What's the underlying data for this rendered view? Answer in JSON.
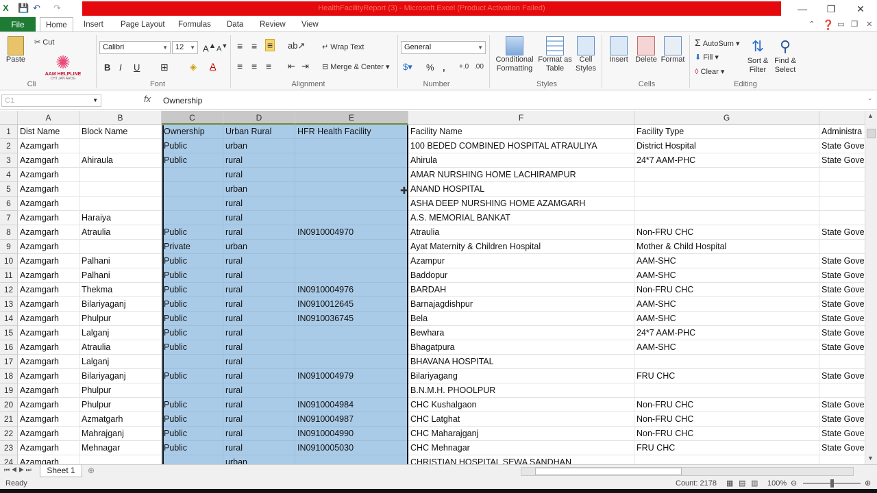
{
  "window": {
    "title": "HealthFacilityReport (3) - Microsoft Excel (Product Activation Failed)",
    "minimize": "—",
    "restore": "❐",
    "close": "✕"
  },
  "quick_access": {
    "save": "💾",
    "undo": "↶",
    "redo": "↷"
  },
  "ribbon_tabs": [
    "Home",
    "Insert",
    "Page Layout",
    "Formulas",
    "Data",
    "Review",
    "View"
  ],
  "file_tab": "File",
  "clipboard": {
    "paste": "Paste",
    "cut": "Cut",
    "label": "Cli"
  },
  "font": {
    "name": "Calibri",
    "size": "12",
    "bold": "B",
    "italic": "I",
    "underline": "U",
    "label": "Font"
  },
  "alignment": {
    "wrap": "Wrap Text",
    "merge": "Merge & Center",
    "label": "Alignment"
  },
  "number": {
    "format": "General",
    "percent": "%",
    "comma": ",",
    "label": "Number"
  },
  "styles": {
    "conditional": "Conditional Formatting",
    "as_table": "Format as Table",
    "cell_styles": "Cell Styles",
    "label": "Styles"
  },
  "cells": {
    "insert": "Insert",
    "delete": "Delete",
    "format": "Format",
    "label": "Cells"
  },
  "editing": {
    "autosum": "AutoSum",
    "fill": "Fill",
    "clear": "Clear",
    "sort": "Sort & Filter",
    "find": "Find & Select",
    "label": "Editing"
  },
  "logo": {
    "text": "AAM HELPLINE",
    "sub": "CHT JAN AROG"
  },
  "formula_bar": {
    "name_box": "C1",
    "fx": "fx",
    "content": "Ownership"
  },
  "columns": [
    {
      "letter": "A",
      "w": 90
    },
    {
      "letter": "B",
      "w": 120
    },
    {
      "letter": "C",
      "w": 90
    },
    {
      "letter": "D",
      "w": 105
    },
    {
      "letter": "E",
      "w": 165
    },
    {
      "letter": "F",
      "w": 330
    },
    {
      "letter": "G",
      "w": 270
    },
    {
      "letter": "",
      "w": 70
    }
  ],
  "rows": [
    [
      "Dist Name",
      "Block Name",
      "Ownership",
      "Urban Rural",
      "HFR Health Facility",
      "Facility Name",
      "Facility Type",
      "Administra"
    ],
    [
      "Azamgarh",
      "",
      "Public",
      "urban",
      "",
      "100 BEDED COMBINED HOSPITAL ATRAULIYA",
      "District Hospital",
      "State Gove"
    ],
    [
      "Azamgarh",
      "Ahiraula",
      "Public",
      "rural",
      "",
      "Ahirula",
      "24*7 AAM-PHC",
      "State Gove"
    ],
    [
      "Azamgarh",
      "",
      "",
      "rural",
      "",
      "AMAR NURSHING HOME LACHIRAMPUR",
      "",
      ""
    ],
    [
      "Azamgarh",
      "",
      "",
      "urban",
      "",
      "ANAND HOSPITAL",
      "",
      ""
    ],
    [
      "Azamgarh",
      "",
      "",
      "rural",
      "",
      "ASHA DEEP NURSHING HOME AZAMGARH",
      "",
      ""
    ],
    [
      "Azamgarh",
      "Haraiya",
      "",
      "rural",
      "",
      "A.S. MEMORIAL BANKAT",
      "",
      ""
    ],
    [
      "Azamgarh",
      "Atraulia",
      "Public",
      "rural",
      "IN0910004970",
      "Atraulia",
      "Non-FRU CHC",
      "State Gove"
    ],
    [
      "Azamgarh",
      "",
      "Private",
      "urban",
      "",
      "Ayat Maternity & Children Hospital",
      "Mother & Child Hospital",
      ""
    ],
    [
      "Azamgarh",
      "Palhani",
      "Public",
      "rural",
      "",
      "Azampur",
      "AAM-SHC",
      "State Gove"
    ],
    [
      "Azamgarh",
      "Palhani",
      "Public",
      "rural",
      "",
      "Baddopur",
      "AAM-SHC",
      "State Gove"
    ],
    [
      "Azamgarh",
      "Thekma",
      "Public",
      "rural",
      "IN0910004976",
      "BARDAH",
      "Non-FRU CHC",
      "State Gove"
    ],
    [
      "Azamgarh",
      "Bilariyaganj",
      "Public",
      "rural",
      "IN0910012645",
      "Barnajagdishpur",
      "AAM-SHC",
      "State Gove"
    ],
    [
      "Azamgarh",
      "Phulpur",
      "Public",
      "rural",
      "IN0910036745",
      "Bela",
      "AAM-SHC",
      "State Gove"
    ],
    [
      "Azamgarh",
      "Lalganj",
      "Public",
      "rural",
      "",
      "Bewhara",
      "24*7 AAM-PHC",
      "State Gove"
    ],
    [
      "Azamgarh",
      "Atraulia",
      "Public",
      "rural",
      "",
      "Bhagatpura",
      "AAM-SHC",
      "State Gove"
    ],
    [
      "Azamgarh",
      "Lalganj",
      "",
      "rural",
      "",
      "BHAVANA HOSPITAL",
      "",
      ""
    ],
    [
      "Azamgarh",
      "Bilariyaganj",
      "Public",
      "rural",
      "IN0910004979",
      "Bilariyagang",
      "FRU CHC",
      "State Gove"
    ],
    [
      "Azamgarh",
      "Phulpur",
      "",
      "rural",
      "",
      "B.N.M.H. PHOOLPUR",
      "",
      ""
    ],
    [
      "Azamgarh",
      "Phulpur",
      "Public",
      "rural",
      "IN0910004984",
      "CHC Kushalgaon",
      "Non-FRU CHC",
      "State Gove"
    ],
    [
      "Azamgarh",
      "Azmatgarh",
      "Public",
      "rural",
      "IN0910004987",
      "CHC Latghat",
      "Non-FRU CHC",
      "State Gove"
    ],
    [
      "Azamgarh",
      "Mahrajganj",
      "Public",
      "rural",
      "IN0910004990",
      "CHC Maharajganj",
      "Non-FRU CHC",
      "State Gove"
    ],
    [
      "Azamgarh",
      "Mehnagar",
      "Public",
      "rural",
      "IN0910005030",
      "CHC Mehnagar",
      "FRU CHC",
      "State Gove"
    ],
    [
      "Azamgarh",
      "",
      "",
      "urban",
      "",
      "CHRISTIAN HOSPITAL SEWA SANDHAN",
      "",
      ""
    ]
  ],
  "sheet": {
    "name": "Sheet 1"
  },
  "status": {
    "ready": "Ready",
    "count": "Count: 2178",
    "zoom": "100%"
  }
}
